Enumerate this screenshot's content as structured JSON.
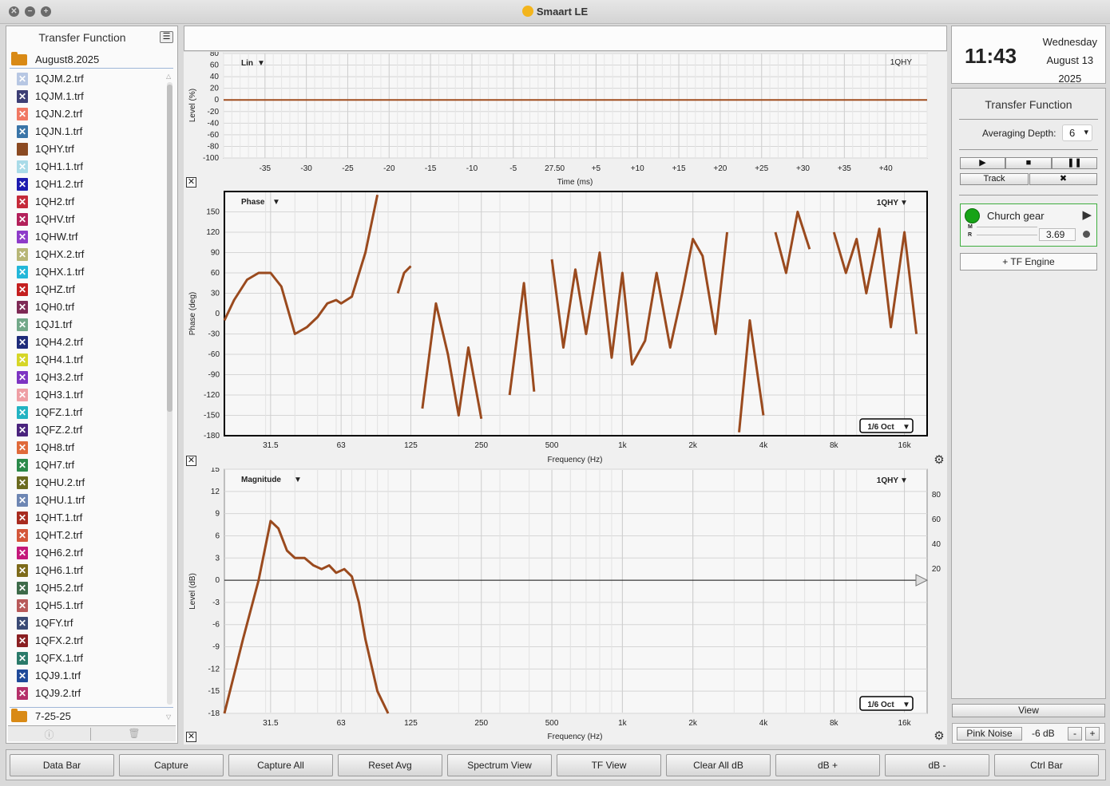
{
  "app": {
    "title": "Smaart LE"
  },
  "sidebar": {
    "title": "Transfer Function",
    "folder_top": "August8.2025",
    "folder_bottom": "7-25-25",
    "files": [
      {
        "name": "1QJM.2.trf",
        "color": "#b7c7e3"
      },
      {
        "name": "1QJM.1.trf",
        "color": "#3d3f75"
      },
      {
        "name": "1QJN.2.trf",
        "color": "#f07863"
      },
      {
        "name": "1QJN.1.trf",
        "color": "#3a75a8"
      },
      {
        "name": "1QHY.trf",
        "color": "#8b4a22",
        "icon": "file-icon"
      },
      {
        "name": "1QH1.1.trf",
        "color": "#a9dbe8"
      },
      {
        "name": "1QH1.2.trf",
        "color": "#1d1bb0"
      },
      {
        "name": "1QH2.trf",
        "color": "#c52a3a"
      },
      {
        "name": "1QHV.trf",
        "color": "#b3205a"
      },
      {
        "name": "1QHW.trf",
        "color": "#8e3bc9"
      },
      {
        "name": "1QHX.2.trf",
        "color": "#b7b676"
      },
      {
        "name": "1QHX.1.trf",
        "color": "#23b7d9"
      },
      {
        "name": "1QHZ.trf",
        "color": "#c41f1f"
      },
      {
        "name": "1QH0.trf",
        "color": "#7e2a55"
      },
      {
        "name": "1QJ1.trf",
        "color": "#72a889"
      },
      {
        "name": "1QH4.2.trf",
        "color": "#1e2b7a"
      },
      {
        "name": "1QH4.1.trf",
        "color": "#d6d627"
      },
      {
        "name": "1QH3.2.trf",
        "color": "#7d34c2"
      },
      {
        "name": "1QH3.1.trf",
        "color": "#ee9ea4"
      },
      {
        "name": "1QFZ.1.trf",
        "color": "#22b3c2"
      },
      {
        "name": "1QFZ.2.trf",
        "color": "#4a237d"
      },
      {
        "name": "1QH8.trf",
        "color": "#e06a3a"
      },
      {
        "name": "1QH7.trf",
        "color": "#2b8a4a"
      },
      {
        "name": "1QHU.2.trf",
        "color": "#6a6a1f"
      },
      {
        "name": "1QHU.1.trf",
        "color": "#6d86b3"
      },
      {
        "name": "1QHT.1.trf",
        "color": "#a82b1f"
      },
      {
        "name": "1QHT.2.trf",
        "color": "#d4573a"
      },
      {
        "name": "1QH6.2.trf",
        "color": "#c4187a"
      },
      {
        "name": "1QH6.1.trf",
        "color": "#7d6a1a"
      },
      {
        "name": "1QH5.2.trf",
        "color": "#3e6b4a"
      },
      {
        "name": "1QH5.1.trf",
        "color": "#b85a5a"
      },
      {
        "name": "1QFY.trf",
        "color": "#3a4a75"
      },
      {
        "name": "1QFX.2.trf",
        "color": "#8a1f22"
      },
      {
        "name": "1QFX.1.trf",
        "color": "#2a7a6a"
      },
      {
        "name": "1QJ9.1.trf",
        "color": "#1f4a9a"
      },
      {
        "name": "1QJ9.2.trf",
        "color": "#b5306a"
      }
    ]
  },
  "plots": {
    "impulse": {
      "mode_label": "Lin",
      "measurement": "1QHY",
      "ylabel": "Level (%)",
      "xlabel": "Time (ms)",
      "yticks": [
        "80",
        "60",
        "40",
        "20",
        "0",
        "-20",
        "-40",
        "-60",
        "-80",
        "-100"
      ],
      "xticks": [
        "-35",
        "-30",
        "-25",
        "-20",
        "-15",
        "-10",
        "-5",
        "27.50",
        "+5",
        "+10",
        "+15",
        "+20",
        "+25",
        "+30",
        "+35",
        "+40"
      ]
    },
    "phase": {
      "mode_label": "Phase",
      "measurement": "1QHY",
      "ylabel": "Phase (deg)",
      "xlabel": "Frequency (Hz)",
      "smoothing": "1/6 Oct",
      "yticks": [
        "150",
        "120",
        "90",
        "60",
        "30",
        "0",
        "-30",
        "-60",
        "-90",
        "-120",
        "-150",
        "-180"
      ],
      "xticks": [
        "31.5",
        "63",
        "125",
        "250",
        "500",
        "1k",
        "2k",
        "4k",
        "8k",
        "16k"
      ]
    },
    "magnitude": {
      "mode_label": "Magnitude",
      "measurement": "1QHY",
      "ylabel": "Level (dB)",
      "xlabel": "Frequency (Hz)",
      "smoothing": "1/6 Oct",
      "yticks": [
        "15",
        "12",
        "9",
        "6",
        "3",
        "0",
        "-3",
        "-6",
        "-9",
        "-12",
        "-15",
        "-18"
      ],
      "right_ticks": [
        "80",
        "60",
        "40",
        "20"
      ],
      "xticks": [
        "31.5",
        "63",
        "125",
        "250",
        "500",
        "1k",
        "2k",
        "4k",
        "8k",
        "16k"
      ]
    }
  },
  "chart_data": [
    {
      "type": "line",
      "title": "Lin",
      "xlabel": "Time (ms)",
      "ylabel": "Level (%)",
      "ylim": [
        -100,
        80
      ],
      "series": [
        {
          "name": "1QHY",
          "x": [
            -40,
            45
          ],
          "values": [
            0,
            0
          ]
        }
      ]
    },
    {
      "type": "line",
      "title": "Phase",
      "xlabel": "Frequency (Hz)",
      "ylabel": "Phase (deg)",
      "ylim": [
        -180,
        180
      ],
      "series": [
        {
          "name": "1QHY",
          "x": [
            20,
            22,
            25,
            28,
            31.5,
            35,
            40,
            45,
            50,
            55,
            60,
            63,
            70,
            80,
            90,
            100,
            110,
            117,
            125,
            140,
            160,
            180,
            200,
            220,
            250,
            280,
            330,
            380,
            420,
            500,
            560,
            630,
            700,
            800,
            900,
            1000,
            1100,
            1250,
            1400,
            1600,
            1800,
            2000,
            2200,
            2500,
            2800,
            3150,
            3500,
            4000,
            4500,
            5000,
            5600,
            6300,
            7000,
            8000,
            9000,
            10000,
            11000,
            12500,
            14000,
            16000,
            18000
          ],
          "values": [
            -10,
            20,
            50,
            60,
            60,
            40,
            -30,
            -20,
            -5,
            15,
            20,
            15,
            25,
            90,
            175,
            -160,
            30,
            60,
            70,
            -140,
            15,
            -60,
            -150,
            -50,
            -155,
            80,
            -120,
            45,
            -115,
            80,
            -50,
            65,
            -30,
            90,
            -65,
            60,
            -75,
            -40,
            60,
            -50,
            30,
            110,
            85,
            -30,
            120,
            -175,
            -10,
            -150,
            120,
            60,
            150,
            95,
            -170,
            120,
            60,
            110,
            30,
            125,
            -20,
            120,
            -30
          ]
        }
      ]
    },
    {
      "type": "line",
      "title": "Magnitude",
      "xlabel": "Frequency (Hz)",
      "ylabel": "Level (dB)",
      "ylim": [
        -18,
        15
      ],
      "series": [
        {
          "name": "1QHY",
          "x": [
            20,
            24,
            28,
            31.5,
            34,
            37,
            40,
            44,
            48,
            52,
            56,
            60,
            65,
            70,
            75,
            80,
            90,
            100
          ],
          "values": [
            -18,
            -8,
            0,
            8,
            7,
            4,
            3,
            3,
            2,
            1.5,
            2,
            1,
            1.5,
            0.5,
            -3,
            -8,
            -15,
            -18
          ]
        }
      ]
    }
  ],
  "clock": {
    "time": "11:43",
    "weekday": "Wednesday",
    "date": "August 13",
    "year": "2025"
  },
  "rpanel": {
    "title": "Transfer Function",
    "avg_label": "Averaging Depth:",
    "avg_value": "6",
    "track_label": "Track",
    "engine_name": "Church gear",
    "engine_m": "M",
    "engine_r": "R",
    "engine_value": "3.69",
    "add_engine": "+ TF Engine",
    "view_label": "View",
    "gen_label": "Pink Noise",
    "gen_level": "-6 dB",
    "gen_minus": "-",
    "gen_plus": "+"
  },
  "bottom_bar": [
    "Data Bar",
    "Capture",
    "Capture All",
    "Reset Avg",
    "Spectrum View",
    "TF View",
    "Clear All dB",
    "dB +",
    "dB -",
    "Ctrl Bar"
  ]
}
